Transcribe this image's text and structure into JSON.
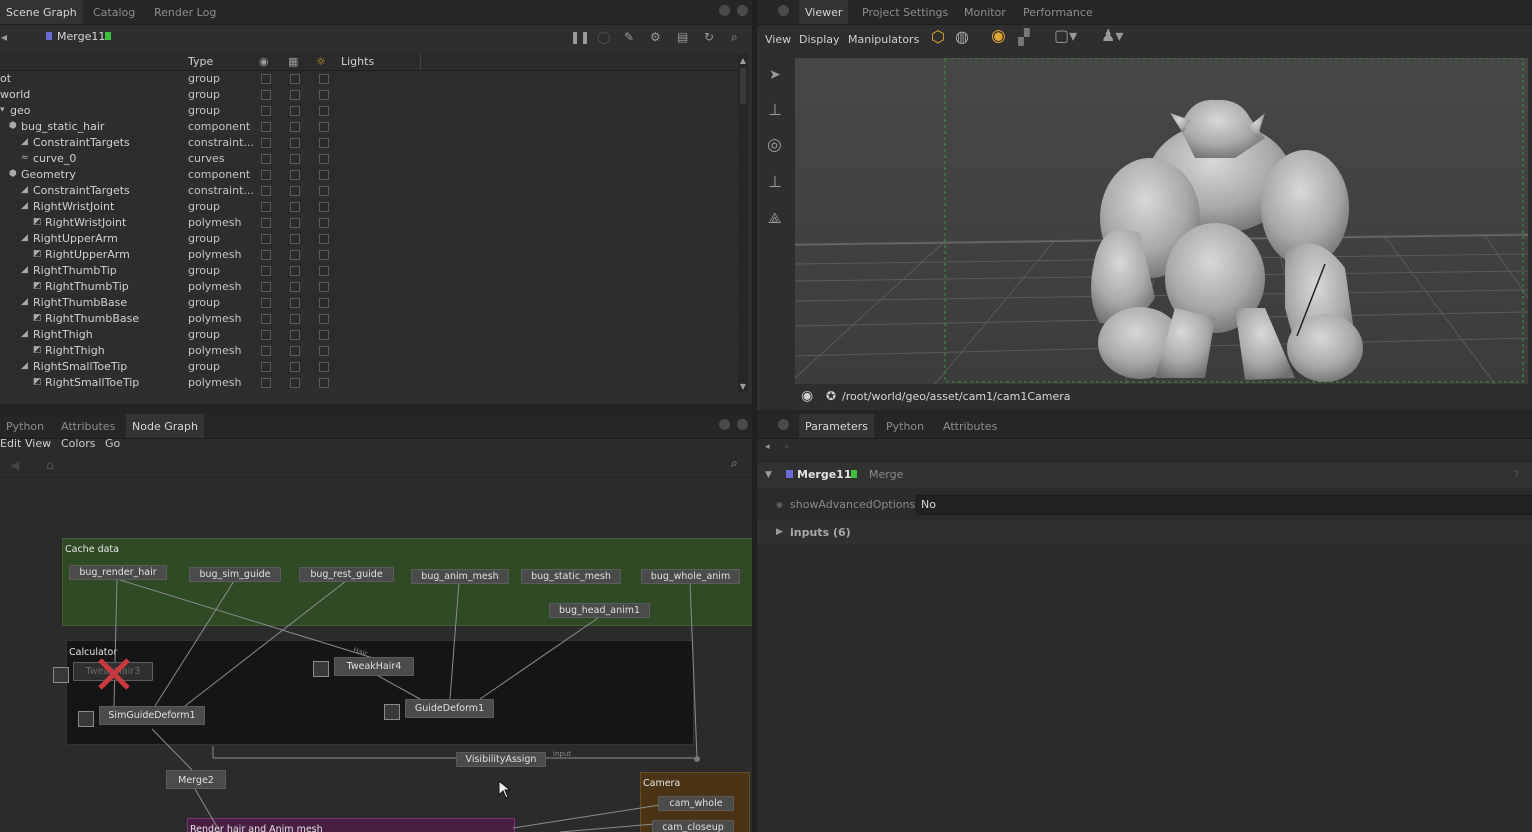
{
  "scene_graph": {
    "tabs": [
      "Scene Graph",
      "Catalog",
      "Render Log"
    ],
    "current_node": "Merge11",
    "columns": {
      "name": "",
      "type": "Type",
      "lights": "Lights"
    },
    "rows": [
      {
        "name": "ot",
        "type": "group"
      },
      {
        "name": "world",
        "type": "group"
      },
      {
        "name": "geo",
        "type": "group"
      },
      {
        "name": "bug_static_hair",
        "type": "component"
      },
      {
        "name": "ConstraintTargets",
        "type": "constraint..."
      },
      {
        "name": "curve_0",
        "type": "curves"
      },
      {
        "name": "Geometry",
        "type": "component"
      },
      {
        "name": "ConstraintTargets",
        "type": "constraint..."
      },
      {
        "name": "RightWristJoint",
        "type": "group"
      },
      {
        "name": "RightWristJoint",
        "type": "polymesh"
      },
      {
        "name": "RightUpperArm",
        "type": "group"
      },
      {
        "name": "RightUpperArm",
        "type": "polymesh"
      },
      {
        "name": "RightThumbTip",
        "type": "group"
      },
      {
        "name": "RightThumbTip",
        "type": "polymesh"
      },
      {
        "name": "RightThumbBase",
        "type": "group"
      },
      {
        "name": "RightThumbBase",
        "type": "polymesh"
      },
      {
        "name": "RightThigh",
        "type": "group"
      },
      {
        "name": "RightThigh",
        "type": "polymesh"
      },
      {
        "name": "RightSmallToeTip",
        "type": "group"
      },
      {
        "name": "RightSmallToeTip",
        "type": "polymesh"
      }
    ]
  },
  "viewer": {
    "tabs": [
      "Viewer",
      "Project Settings",
      "Monitor",
      "Performance"
    ],
    "menus": [
      "View",
      "Display",
      "Manipulators"
    ],
    "camera_path": "/root/world/geo/asset/cam1/cam1Camera"
  },
  "node_graph": {
    "tabs": [
      "Python",
      "Attributes",
      "Node Graph"
    ],
    "menus": [
      "Edit",
      "View",
      "Colors",
      "Go"
    ],
    "backdrops": {
      "cache": "Cache data",
      "calculator": "Calculator",
      "camera": "Camera",
      "render": "Render hair and Anim mesh"
    },
    "nodes": {
      "bug_render_hair": "bug_render_hair",
      "bug_sim_guide": "bug_sim_guide",
      "bug_rest_guide": "bug_rest_guide",
      "bug_anim_mesh": "bug_anim_mesh",
      "bug_static_mesh": "bug_static_mesh",
      "bug_whole_anim": "bug_whole_anim",
      "bug_head_anim1": "bug_head_anim1",
      "tweakhair3": "TweakHair3",
      "tweakhair4": "TweakHair4",
      "simguidedeform1": "SimGuideDeform1",
      "guidedeform1": "GuideDeform1",
      "visibilityassign": "VisibilityAssign",
      "merge2": "Merge2",
      "cam_whole": "cam_whole",
      "cam_closeup": "cam_closeup"
    },
    "edge_labels": {
      "hair": "Hair",
      "input": "input"
    }
  },
  "parameters": {
    "tabs": [
      "Parameters",
      "Python",
      "Attributes"
    ],
    "node_name": "Merge11",
    "node_type": "Merge",
    "show_advanced_label": "showAdvancedOptions",
    "show_advanced_value": "No",
    "inputs_label": "inputs (6)"
  },
  "colors": {
    "cache_backdrop": "#2f4a25",
    "calculator_backdrop": "#151515",
    "camera_backdrop": "#4a3415",
    "render_backdrop": "#4a1f44",
    "merge_icon_blue": "#6b6bd6",
    "merge_icon_green": "#3ec23e",
    "disabled_x": "#c8383f"
  }
}
